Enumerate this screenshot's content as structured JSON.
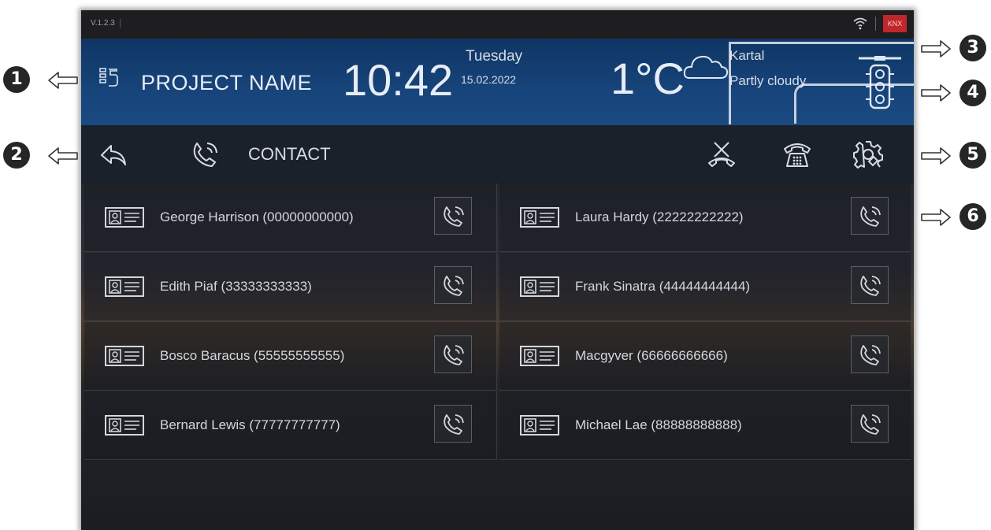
{
  "status_bar": {
    "version": "V.1.2.3",
    "knx": "KNX"
  },
  "header": {
    "project_name": "PROJECT NAME",
    "time": "10:42",
    "day": "Tuesday",
    "date": "15.02.2022",
    "temperature": "1°C",
    "city": "Kartal",
    "weather": "Partly cloudy"
  },
  "toolbar": {
    "title": "CONTACT"
  },
  "contacts": [
    {
      "name": "George Harrison (00000000000)"
    },
    {
      "name": "Laura Hardy (22222222222)"
    },
    {
      "name": "Edith Piaf (33333333333)"
    },
    {
      "name": "Frank Sinatra (44444444444)"
    },
    {
      "name": "Bosco Baracus (55555555555)"
    },
    {
      "name": "Macgyver (66666666666)"
    },
    {
      "name": "Bernard Lewis (77777777777)"
    },
    {
      "name": "Michael Lae (88888888888)"
    }
  ],
  "callouts": [
    "1",
    "2",
    "3",
    "4",
    "5",
    "6"
  ],
  "colors": {
    "header_blue": "#17447a",
    "knx_red": "#c0272d",
    "callout_bg": "#262627"
  }
}
